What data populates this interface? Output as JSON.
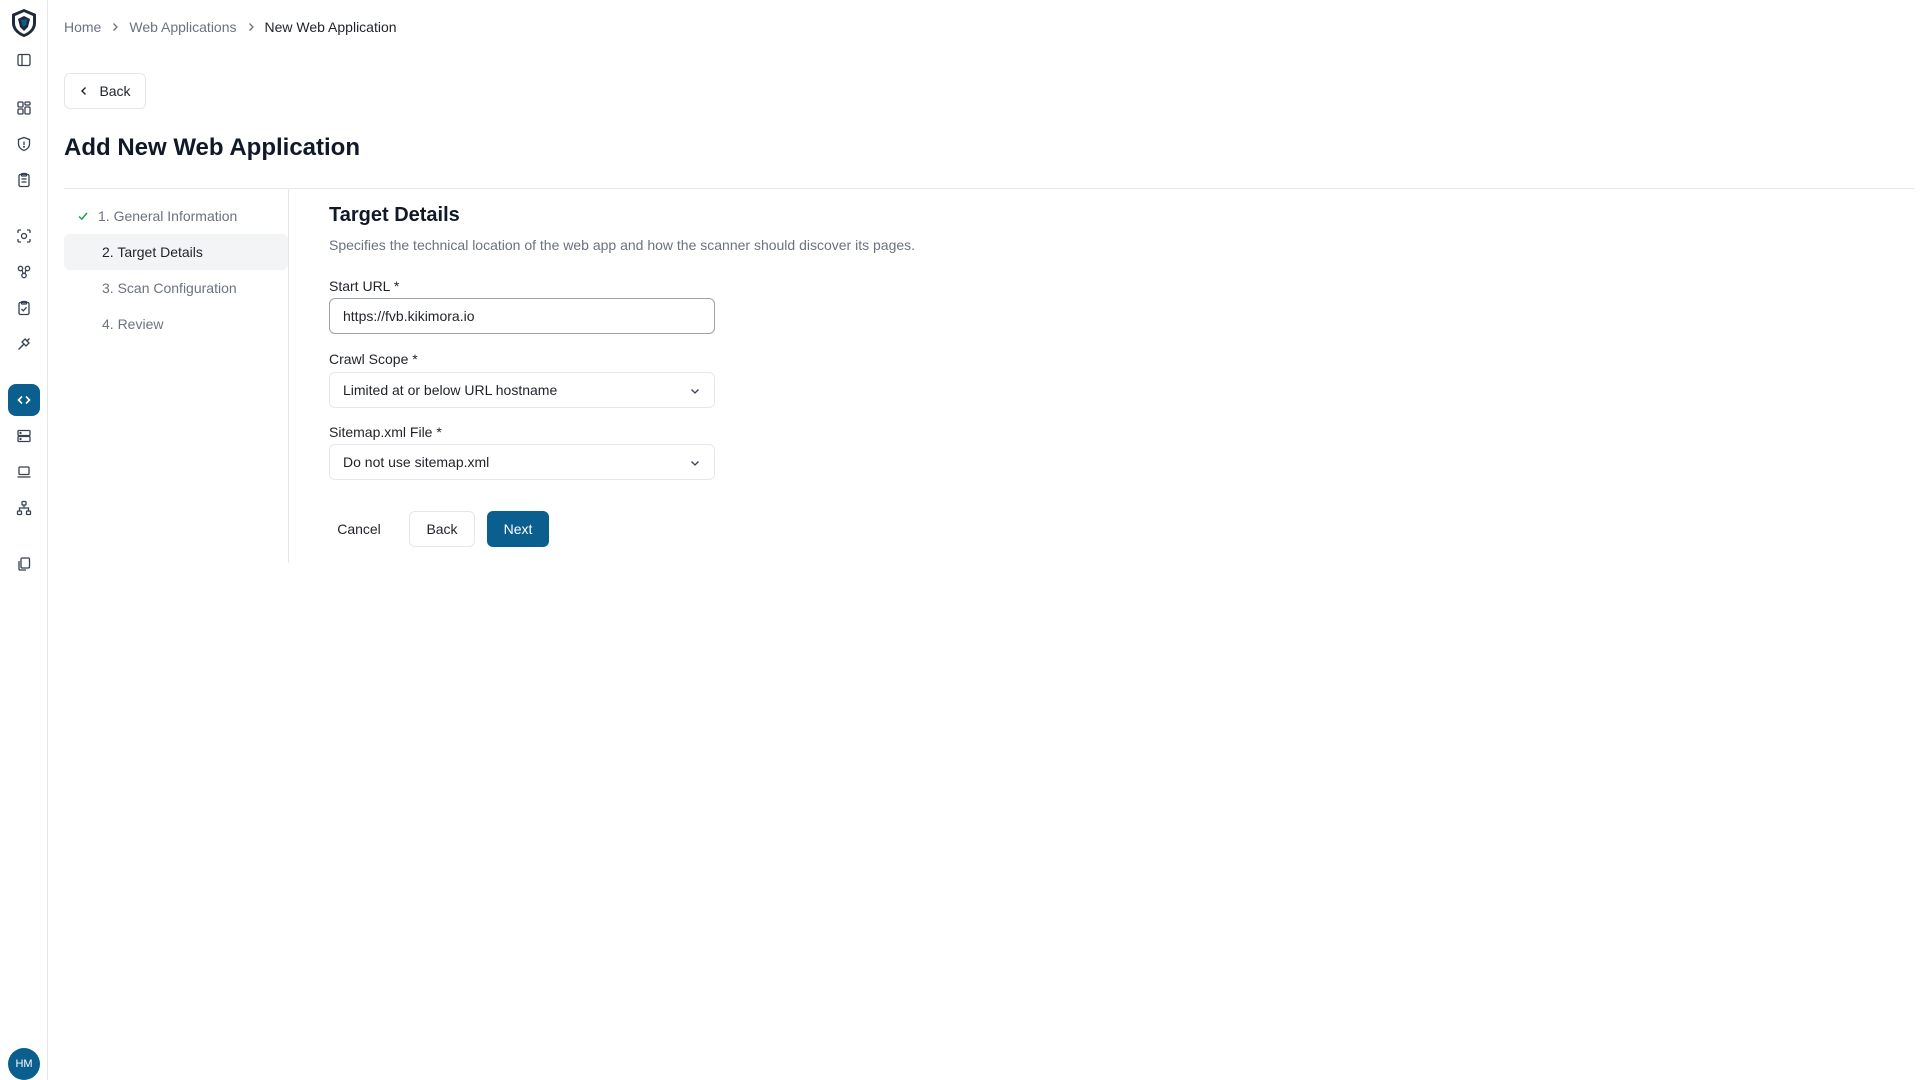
{
  "sidebar": {
    "icons": [
      "panel-toggle-icon",
      "dashboard-icon",
      "shield-icon",
      "clipboard-icon",
      "scan-icon",
      "nodes-icon",
      "clipboard-check-icon",
      "plug-icon",
      "code-icon",
      "server-icon",
      "laptop-icon",
      "network-icon",
      "documents-icon"
    ],
    "active": "code-icon",
    "avatar": "HM"
  },
  "breadcrumb": {
    "home": "Home",
    "parent": "Web Applications",
    "current": "New Web Application"
  },
  "back_top_label": "Back",
  "page_title": "Add New Web Application",
  "steps": [
    {
      "label": "1. General Information",
      "status": "done"
    },
    {
      "label": "2. Target Details",
      "status": "active"
    },
    {
      "label": "3. Scan Configuration",
      "status": "pending"
    },
    {
      "label": "4. Review",
      "status": "pending"
    }
  ],
  "section": {
    "title": "Target Details",
    "description": "Specifies the technical location of the web app and how the scanner should discover its pages."
  },
  "form": {
    "start_url": {
      "label": "Start URL *",
      "value": "https://fvb.kikimora.io"
    },
    "crawl_scope": {
      "label": "Crawl Scope *",
      "value": "Limited at or below URL hostname"
    },
    "sitemap": {
      "label": "Sitemap.xml File *",
      "value": "Do not use sitemap.xml"
    }
  },
  "buttons": {
    "cancel": "Cancel",
    "back": "Back",
    "next": "Next"
  },
  "colors": {
    "accent": "#0b5f8f",
    "check": "#16a34a"
  }
}
